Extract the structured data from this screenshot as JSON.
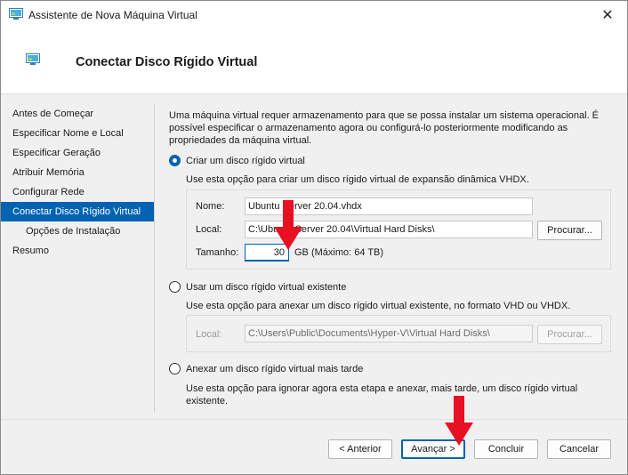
{
  "window": {
    "title": "Assistente de Nova Máquina Virtual",
    "close_glyph": "✕"
  },
  "header": {
    "title": "Conectar Disco Rígido Virtual"
  },
  "nav": {
    "items": [
      {
        "label": "Antes de Começar"
      },
      {
        "label": "Especificar Nome e Local"
      },
      {
        "label": "Especificar Geração"
      },
      {
        "label": "Atribuir Memória"
      },
      {
        "label": "Configurar Rede"
      },
      {
        "label": "Conectar Disco Rígido Virtual"
      },
      {
        "label": "Opções de Instalação"
      },
      {
        "label": "Resumo"
      }
    ]
  },
  "main": {
    "intro": "Uma máquina virtual requer armazenamento para que se possa instalar um sistema operacional. É possível especificar o armazenamento agora ou configurá-lo posteriormente modificando as propriedades da máquina virtual.",
    "option_create": {
      "label": "Criar um disco rígido virtual",
      "description": "Use esta opção para criar um disco rígido virtual de expansão dinâmica VHDX.",
      "name_label": "Nome:",
      "name_value": "Ubuntu Server 20.04.vhdx",
      "location_label": "Local:",
      "location_value": "C:\\Ubuntu Server 20.04\\Virtual Hard Disks\\",
      "browse_label": "Procurar...",
      "size_label": "Tamanho:",
      "size_value": "30",
      "size_unit": "GB (Máximo: 64 TB)"
    },
    "option_existing": {
      "label": "Usar um disco rígido virtual existente",
      "description": "Use esta opção para anexar um disco rígido virtual existente, no formato VHD ou VHDX.",
      "location_label": "Local:",
      "location_value": "C:\\Users\\Public\\Documents\\Hyper-V\\Virtual Hard Disks\\",
      "browse_label": "Procurar..."
    },
    "option_later": {
      "label": "Anexar um disco rígido virtual mais tarde",
      "description": "Use esta opção para ignorar agora esta etapa e anexar, mais tarde, um disco rígido virtual existente."
    }
  },
  "footer": {
    "back_label": "< Anterior",
    "next_label": "Avançar >",
    "finish_label": "Concluir",
    "cancel_label": "Cancelar"
  },
  "colors": {
    "accent": "#0063b1",
    "annotation_arrow": "#e81123"
  },
  "icons": {
    "window": "hyper-v-vm-icon",
    "close": "close-icon",
    "annotation": "red-down-arrow-icon"
  }
}
